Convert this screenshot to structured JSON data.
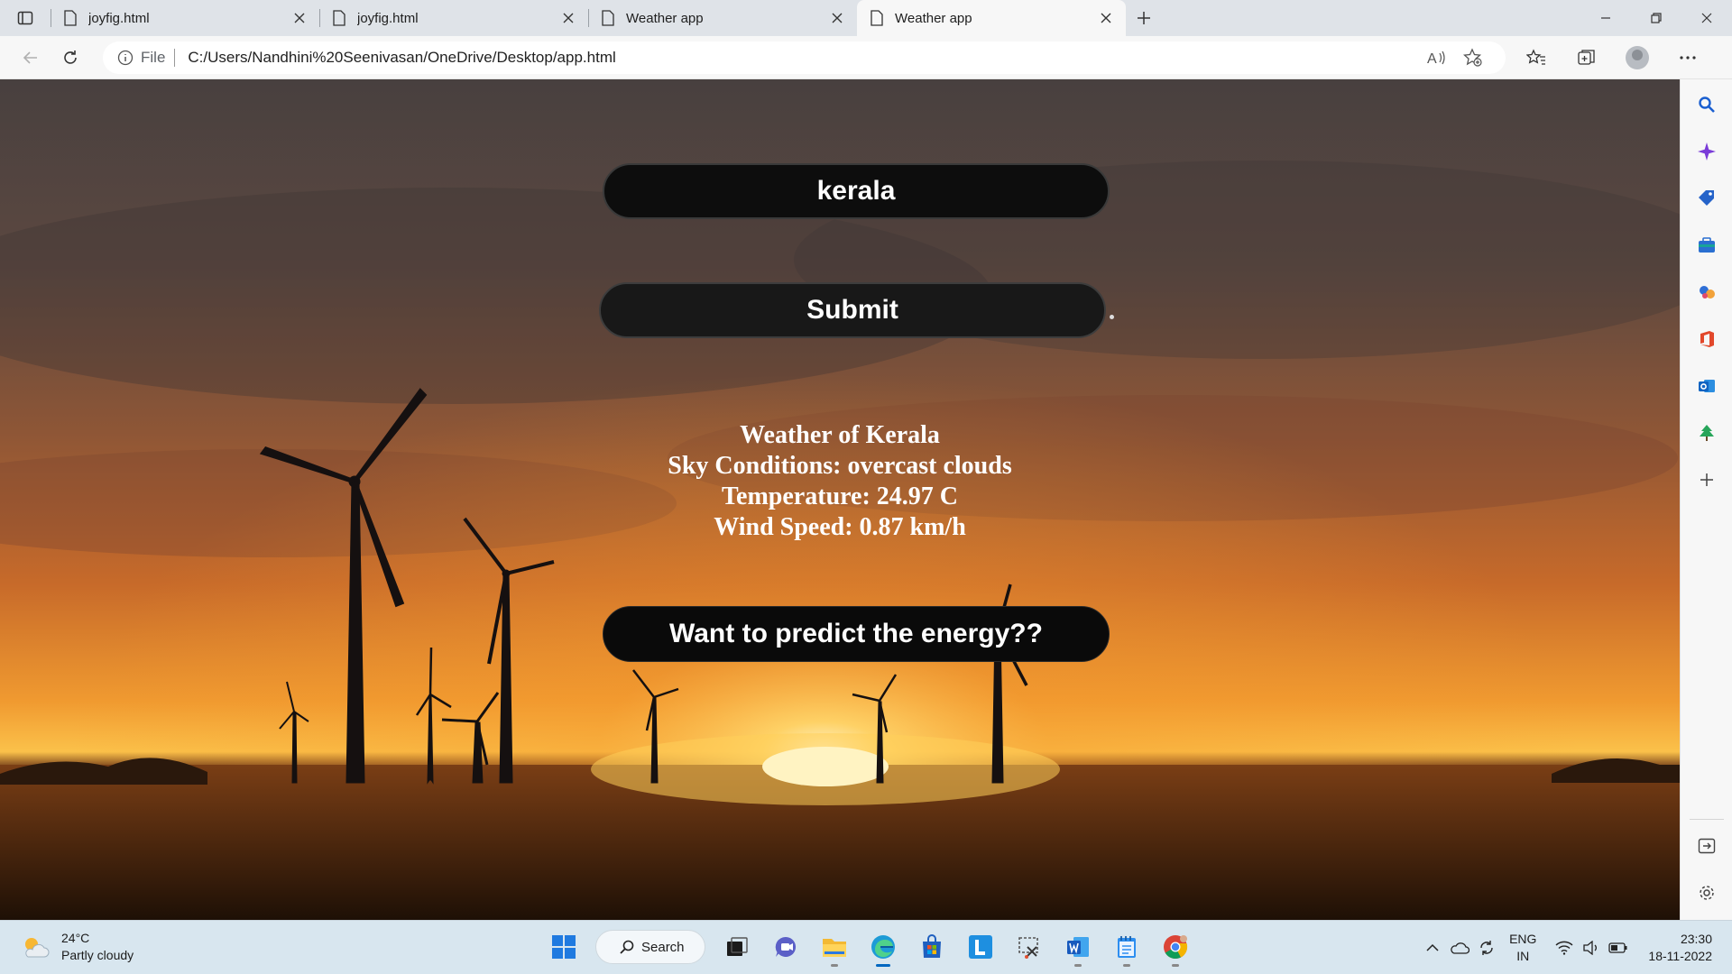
{
  "browser": {
    "tabs": [
      {
        "title": "joyfig.html",
        "active": false
      },
      {
        "title": "joyfig.html",
        "active": false
      },
      {
        "title": "Weather app",
        "active": false
      },
      {
        "title": "Weather app",
        "active": true
      }
    ],
    "address": {
      "scheme_label": "File",
      "url": "C:/Users/Nandhini%20Seenivasan/OneDrive/Desktop/app.html"
    }
  },
  "page": {
    "city_input_value": "kerala",
    "submit_label": "Submit",
    "weather": {
      "heading": "Weather of Kerala",
      "sky": "Sky Conditions: overcast clouds",
      "temperature": "Temperature: 24.97 C",
      "wind": "Wind Speed: 0.87 km/h"
    },
    "predict_label": "Want to predict the energy??"
  },
  "taskbar": {
    "weather_temp": "24°C",
    "weather_desc": "Partly cloudy",
    "search_label": "Search",
    "lang_top": "ENG",
    "lang_bottom": "IN",
    "time": "23:30",
    "date": "18-11-2022"
  },
  "colors": {
    "accent": "#0067c0",
    "sky_top": "#4a4142",
    "horizon": "#f6a431",
    "sun": "#fff4c8"
  }
}
